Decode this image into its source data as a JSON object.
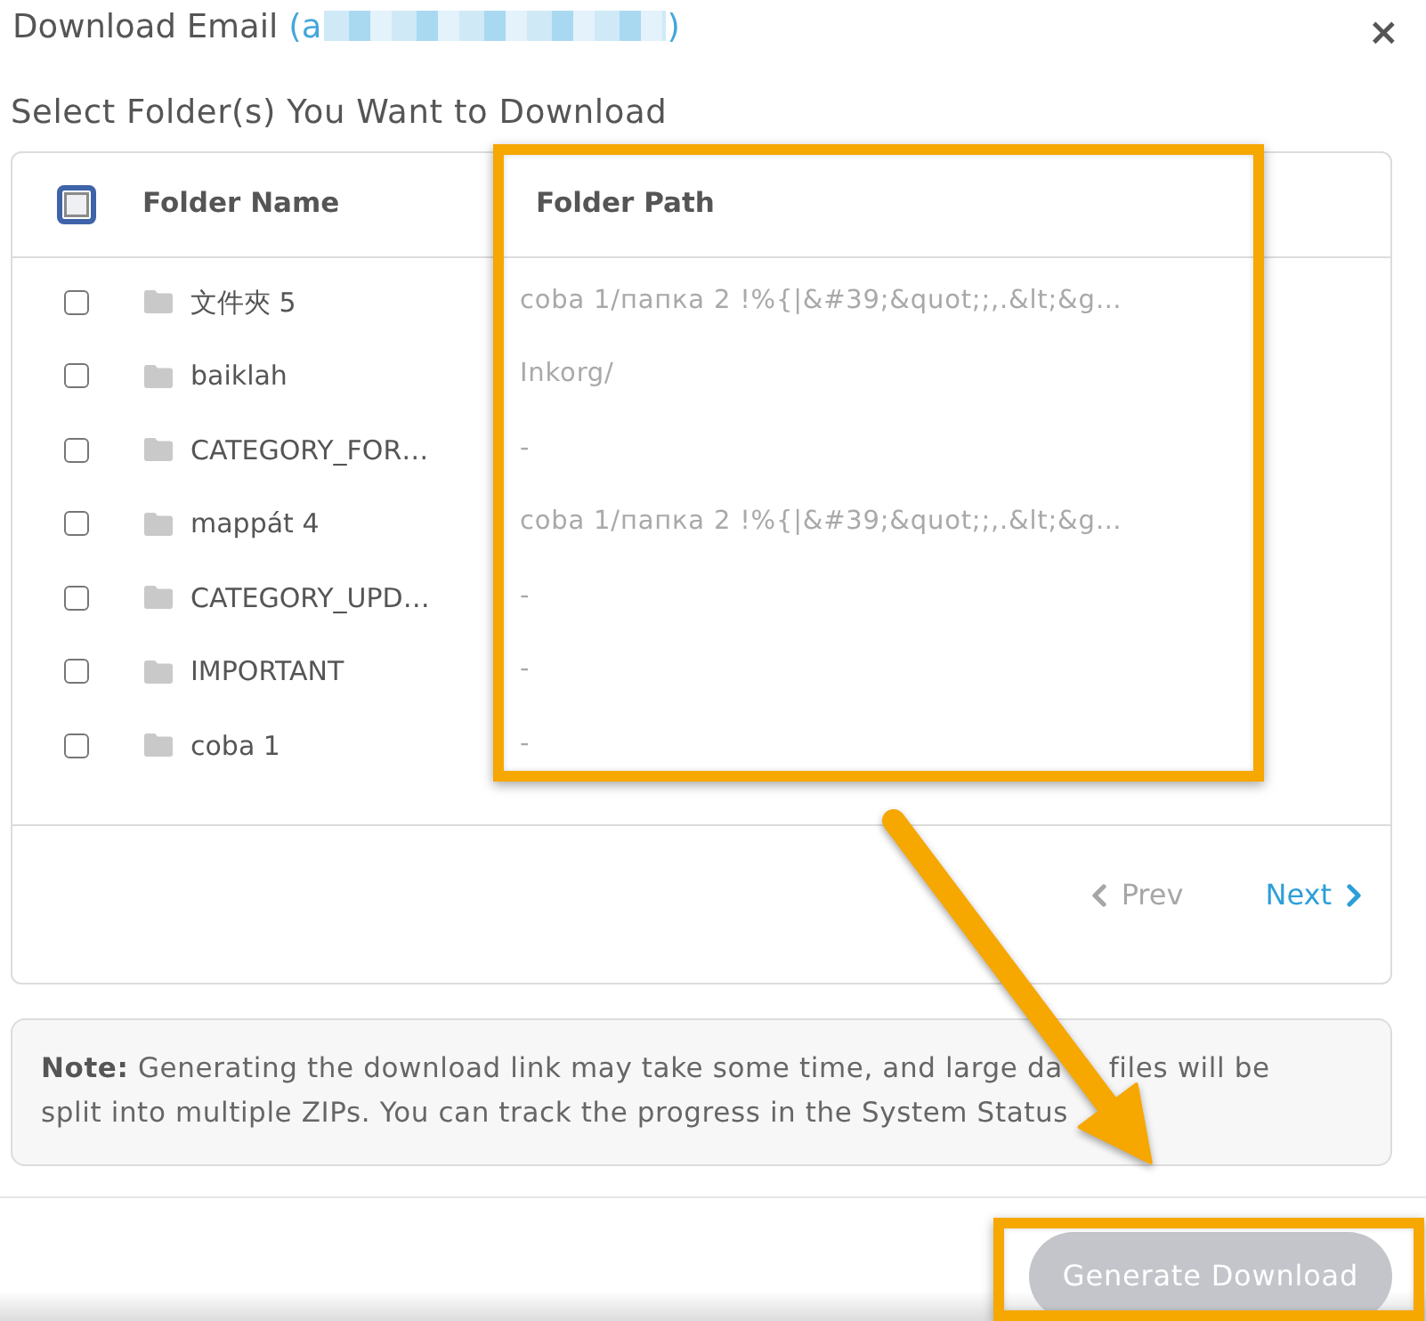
{
  "dialog": {
    "title": "Download Email",
    "email_start": "(a",
    "email_end": ")",
    "email_redacted": true,
    "close": "×"
  },
  "subtitle": "Select Folder(s) You Want to Download",
  "table": {
    "select_all": {
      "checked": false,
      "focused": true
    },
    "columns": [
      {
        "label": "Folder Name",
        "highlighted": false
      },
      {
        "label": "Folder Path",
        "highlighted": true
      }
    ],
    "rows": [
      {
        "name": "文件夾 5",
        "path": "coba 1/папка 2 !%{|&#39;&quot;;,.&lt;&g…",
        "checked": false
      },
      {
        "name": "baiklah",
        "path": "Inkorg/",
        "checked": false
      },
      {
        "name": "CATEGORY_FOR…",
        "path": "-",
        "checked": false
      },
      {
        "name": "mappát 4",
        "path": "coba 1/папка 2 !%{|&#39;&quot;;,.&lt;&g…",
        "checked": false
      },
      {
        "name": "CATEGORY_UPD…",
        "path": "-",
        "checked": false
      },
      {
        "name": "IMPORTANT",
        "path": "-",
        "checked": false
      },
      {
        "name": "coba 1",
        "path": "-",
        "checked": false
      }
    ]
  },
  "pagination": {
    "prev": {
      "label": "Prev",
      "disabled": true
    },
    "next": {
      "label": "Next",
      "disabled": false
    }
  },
  "note": [
    "**Note:** Generating the download link may take some time, and large da",
    "files will be split into multiple ZIPs. You can track the progress in the System Status"
  ],
  "primary_button": {
    "label": "Generate Download",
    "disabled": true,
    "highlighted": true
  },
  "arrow_annotation": true
}
